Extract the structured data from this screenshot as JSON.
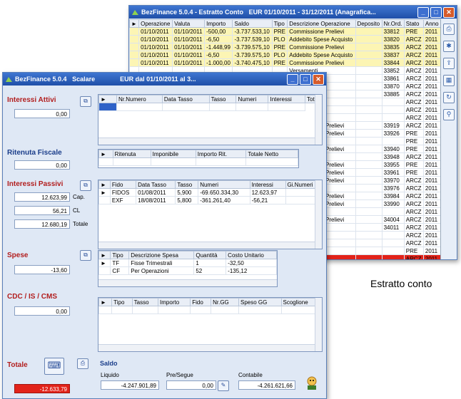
{
  "back_window": {
    "title": "BezFinance 5.0.4 - Estratto Conto",
    "title_parts": [
      "BezFinance 5.0.4",
      "Estratto Conto",
      "EUR",
      "01/10/2011",
      "31/12/2011",
      "(Anagrafica..."
    ],
    "columns": [
      "Operazione",
      "Valuta",
      "Importo",
      "Saldo",
      "Tipo",
      "Descrizione Operazione",
      "Deposito",
      "Nr.Ord.",
      "Stato",
      "Anno"
    ],
    "rows": [
      {
        "op": "01/10/2011",
        "val": "01/10/2011",
        "imp": "-500,00",
        "saldo": "-3.737.533,10",
        "tipo": "PRE",
        "desc": "Commissione Prelievi",
        "dep": "",
        "nr": "33812",
        "stato": "PRE",
        "anno": "2011",
        "hl": true
      },
      {
        "op": "01/10/2011",
        "val": "01/10/2011",
        "imp": "-6,50",
        "saldo": "-3.737.539,10",
        "tipo": "PLO",
        "desc": "Addebito Spese Acquisto",
        "dep": "",
        "nr": "33820",
        "stato": "ARCZ",
        "anno": "2011",
        "hl": true
      },
      {
        "op": "01/10/2011",
        "val": "01/10/2011",
        "imp": "-1.448,99",
        "saldo": "-3.739.575,10",
        "tipo": "PRE",
        "desc": "Commissione Prelievi",
        "dep": "",
        "nr": "33835",
        "stato": "ARCZ",
        "anno": "2011",
        "hl": true
      },
      {
        "op": "01/10/2011",
        "val": "01/10/2011",
        "imp": "-6,50",
        "saldo": "-3.739.575,10",
        "tipo": "PLO",
        "desc": "Addebito Spese Acquisto",
        "dep": "",
        "nr": "33837",
        "stato": "ARCZ",
        "anno": "2011",
        "hl": true
      },
      {
        "op": "01/10/2011",
        "val": "01/10/2011",
        "imp": "-1.000,00",
        "saldo": "-3.740.475,10",
        "tipo": "PRE",
        "desc": "Commissione Prelievi",
        "dep": "",
        "nr": "33844",
        "stato": "ARCZ",
        "anno": "2011",
        "hl": true
      },
      {
        "desc": "Versamenti",
        "nr": "33852",
        "stato": "ARCZ",
        "anno": "2011"
      },
      {
        "desc": "Versamenti",
        "nr": "33861",
        "stato": "ARCZ",
        "anno": "2011"
      },
      {
        "desc": "Versamenti",
        "nr": "33870",
        "stato": "ARCZ",
        "anno": "2011"
      },
      {
        "desc": "Versamenti",
        "nr": "33885",
        "stato": "ARCZ",
        "anno": "2011"
      },
      {
        "desc": "Versamenti",
        "nr": "",
        "stato": "ARCZ",
        "anno": "2011"
      },
      {
        "desc": "Versamenti",
        "nr": "",
        "stato": "ARCZ",
        "anno": "2011"
      },
      {
        "desc": "Versamenti",
        "nr": "",
        "stato": "ARCZ",
        "anno": "2011"
      },
      {
        "desc": "Commissione Prelievi",
        "nr": "33919",
        "stato": "ARCZ",
        "anno": "2011"
      },
      {
        "desc": "Commissione Prelievi",
        "nr": "33926",
        "stato": "PRE",
        "anno": "2011"
      },
      {
        "desc": "Versamenti",
        "nr": "",
        "stato": "PRE",
        "anno": "2011"
      },
      {
        "desc": "Commissione Prelievi",
        "nr": "33940",
        "stato": "PRE",
        "anno": "2011"
      },
      {
        "desc": "Versamenti",
        "nr": "33948",
        "stato": "ARCZ",
        "anno": "2011"
      },
      {
        "desc": "Commissione Prelievi",
        "nr": "33955",
        "stato": "PRE",
        "anno": "2011"
      },
      {
        "desc": "Commissione Prelievi",
        "nr": "33961",
        "stato": "PRE",
        "anno": "2011"
      },
      {
        "desc": "Commissione Prelievi",
        "nr": "33970",
        "stato": "ARCZ",
        "anno": "2011"
      },
      {
        "desc": "Versamenti",
        "nr": "33976",
        "stato": "ARCZ",
        "anno": "2011"
      },
      {
        "desc": "Commissione Prelievi",
        "nr": "33984",
        "stato": "ARCZ",
        "anno": "2011"
      },
      {
        "desc": "Commissione Prelievi",
        "nr": "33990",
        "stato": "ARCZ",
        "anno": "2011"
      },
      {
        "desc": "Versamenti",
        "nr": "",
        "stato": "ARCZ",
        "anno": "2011"
      },
      {
        "desc": "Commissione Prelievi",
        "nr": "34004",
        "stato": "ARCZ",
        "anno": "2011"
      },
      {
        "desc": "Versamenti",
        "nr": "34011",
        "stato": "ARCZ",
        "anno": "2011"
      },
      {
        "desc": "Versamenti",
        "nr": "",
        "stato": "ARCZ",
        "anno": "2011"
      },
      {
        "desc": "Versamenti",
        "nr": "",
        "stato": "ARCZ",
        "anno": "2011"
      },
      {
        "desc": "Versamenti",
        "nr": "",
        "stato": "PRE",
        "anno": "2011"
      },
      {
        "desc": "",
        "nr": "",
        "stato": "ARCZ",
        "anno": "2011",
        "red": true
      }
    ]
  },
  "caption": "Estratto conto",
  "front_window": {
    "title": "BezFinance 5.0.4",
    "subtitle": "Scalare",
    "title_right": "EUR  dal  01/10/2011  al  3...",
    "interessi_attivi": {
      "label": "Interessi Attivi",
      "value": "0,00"
    },
    "grid_attivi": {
      "columns": [
        "Nr.Numero",
        "Data Tasso",
        "Tasso",
        "Numeri",
        "Interessi",
        "Tot"
      ]
    },
    "ritenuta": {
      "label": "Ritenuta Fiscale",
      "value": "0,00"
    },
    "grid_ritenuta": {
      "columns": [
        "Ritenuta",
        "Imponibile",
        "Importo Rit.",
        "Totale Netto"
      ]
    },
    "interessi_passivi": {
      "label": "Interessi Passivi",
      "rows": [
        {
          "value": "12.623,99",
          "unit": "Cap."
        },
        {
          "value": "56,21",
          "unit": "CL"
        },
        {
          "value": "12.680,19",
          "unit": "Totale"
        }
      ]
    },
    "grid_passivi": {
      "columns": [
        "Fido",
        "Data Tasso",
        "Tasso",
        "Numeri",
        "Interessi",
        "Gi.Numeri"
      ],
      "rows": [
        [
          "FIDOS",
          "01/08/2011",
          "5,900",
          "-69.650.334,30",
          "12.623,97",
          ""
        ],
        [
          "EXF",
          "18/08/2011",
          "5,800",
          "-361.261,40",
          "-56,21",
          ""
        ]
      ]
    },
    "spese": {
      "label": "Spese",
      "value": "-13,60"
    },
    "grid_spese": {
      "columns": [
        "Tipo",
        "Descrizione Spesa",
        "Quantità",
        "Costo Unitario"
      ],
      "rows": [
        [
          "TF",
          "Fisse Trimestrali",
          "1",
          "-32,50"
        ],
        [
          "CF",
          "Per Operazioni",
          "52",
          "-135,12"
        ]
      ]
    },
    "cdc": {
      "label": "CDC / IS / CMS",
      "value": "0,00"
    },
    "grid_cdc": {
      "columns": [
        "Tipo",
        "Tasso",
        "Importo",
        "Fido",
        "Nr.GG",
        "Speso GG",
        "Scoglione"
      ]
    },
    "totale": {
      "label": "Totale",
      "value": "-12.633,79"
    },
    "saldo": {
      "label": "Saldo",
      "liquido": {
        "label": "Liquido",
        "value": "-4.247.901,89"
      },
      "partenza": {
        "label": "Pre/Segue",
        "value": "0,00"
      },
      "contabile": {
        "label": "Contabile",
        "value": "-4.261.621,66"
      }
    }
  },
  "colors": {
    "highlight": "#fcf5b4",
    "alert": "#e2231a",
    "label_red": "#b21e1e",
    "titlebar": "#2a5cc0"
  }
}
